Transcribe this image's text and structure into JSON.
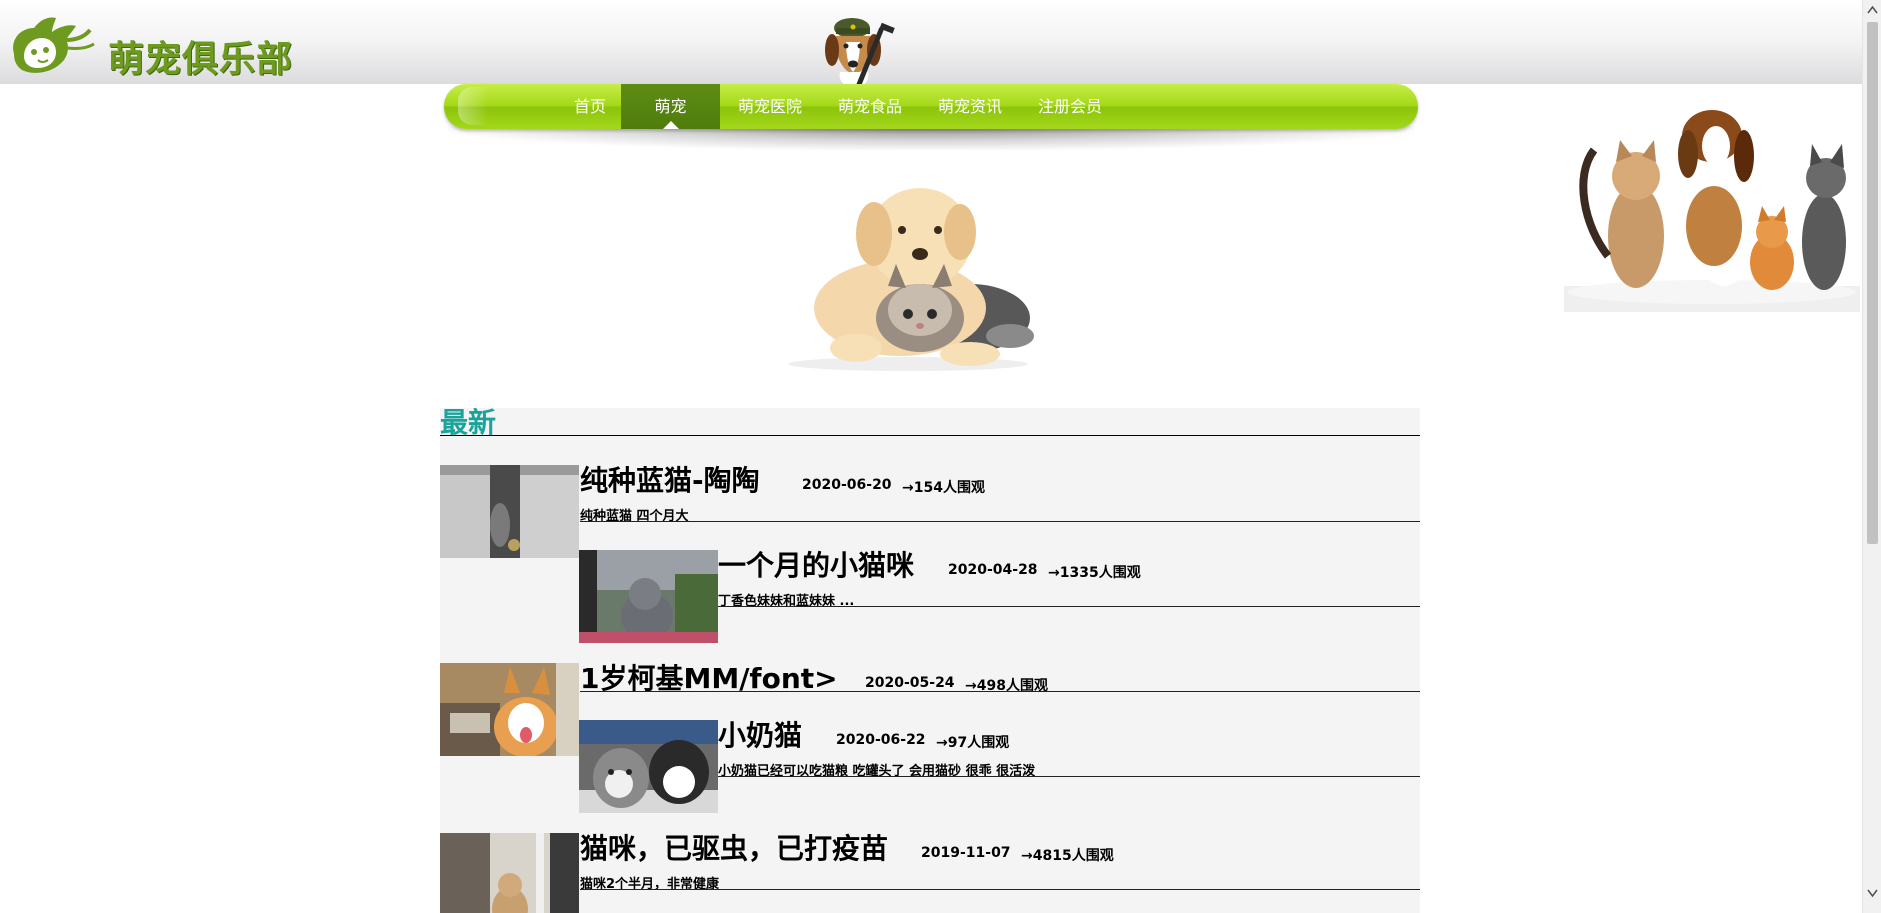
{
  "site": {
    "logo_text": "萌宠俱乐部"
  },
  "nav": {
    "items": [
      {
        "label": "首页"
      },
      {
        "label": "萌宠"
      },
      {
        "label": "萌宠医院"
      },
      {
        "label": "萌宠食品"
      },
      {
        "label": "萌宠资讯"
      },
      {
        "label": "注册会员"
      }
    ],
    "active_index": 1
  },
  "news": {
    "heading": "最新",
    "entries": [
      {
        "title": "纯种蓝猫-陶陶",
        "date": "2020-06-20",
        "views": "→154人围观",
        "desc": "纯种蓝猫 四个月大"
      },
      {
        "title": "一个月的小猫咪",
        "date": "2020-04-28",
        "views": "→1335人围观",
        "desc": "丁香色妹妹和蓝妹妹 ..."
      },
      {
        "title": "1岁柯基MM/font>",
        "date": "2020-05-24",
        "views": "→498人围观",
        "desc": ""
      },
      {
        "title": "小奶猫",
        "date": "2020-06-22",
        "views": "→97人围观",
        "desc": "小奶猫已经可以吃猫粮 吃罐头了 会用猫砂 很乖 很活泼"
      },
      {
        "title": "猫咪，已驱虫，已打疫苗",
        "date": "2019-11-07",
        "views": "→4815人围观",
        "desc": "猫咪2个半月，非常健康"
      }
    ]
  },
  "icons": {
    "logo": "cat-dog-logo-icon",
    "mascot": "beagle-soldier-icon",
    "scroll_up": "chevron-up-icon",
    "scroll_down": "chevron-down-icon"
  },
  "colors": {
    "nav_green": "#a4d817",
    "nav_active": "#4f7c0c",
    "heading_teal": "#1aa39a",
    "logo_green": "#6d9a1f",
    "panel_bg": "#f4f4f4"
  }
}
